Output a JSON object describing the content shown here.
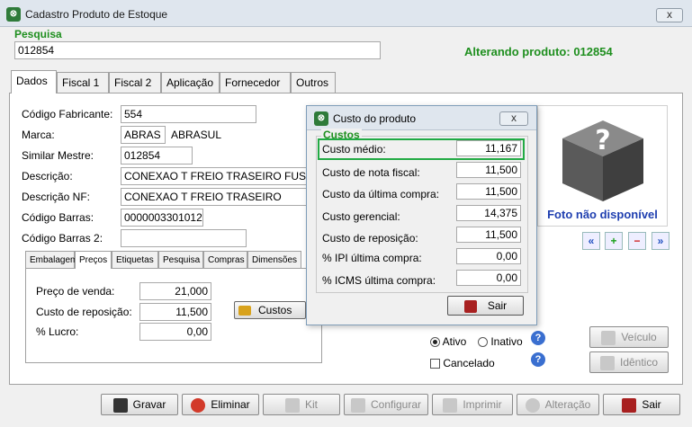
{
  "window": {
    "title": "Cadastro Produto de Estoque",
    "close_glyph": "x"
  },
  "search": {
    "label": "Pesquisa",
    "value": "012854",
    "status": "Alterando produto: 012854"
  },
  "tabs": [
    {
      "label": "Dados"
    },
    {
      "label": "Fiscal 1"
    },
    {
      "label": "Fiscal 2"
    },
    {
      "label": "Aplicação"
    },
    {
      "label": "Fornecedor"
    },
    {
      "label": "Outros"
    }
  ],
  "fields": {
    "codigo_fabricante": {
      "label": "Código Fabricante:",
      "value": "554"
    },
    "marca": {
      "label": "Marca:",
      "value": "ABRAS",
      "name": "ABRASUL"
    },
    "similar_mestre": {
      "label": "Similar Mestre:",
      "value": "012854"
    },
    "descricao": {
      "label": "Descrição:",
      "value": "CONEXAO T FREIO TRASEIRO FUSCA"
    },
    "descricao_nf": {
      "label": "Descrição NF:",
      "value": "CONEXAO T FREIO TRASEIRO"
    },
    "codigo_barras": {
      "label": "Código Barras:",
      "value": "0000003301012"
    },
    "codigo_barras_2": {
      "label": "Código Barras 2:",
      "value": ""
    }
  },
  "subtabs": [
    {
      "label": "Embalagem"
    },
    {
      "label": "Preços"
    },
    {
      "label": "Etiquetas"
    },
    {
      "label": "Pesquisa"
    },
    {
      "label": "Compras"
    },
    {
      "label": "Dimensões"
    }
  ],
  "prices": {
    "preco_venda": {
      "label": "Preço de venda:",
      "value": "21,000"
    },
    "custo_reposicao": {
      "label": "Custo de reposição:",
      "value": "11,500"
    },
    "lucro": {
      "label": "% Lucro:",
      "value": "0,00"
    },
    "custos_button": "Custos"
  },
  "photo": {
    "placeholder": "Foto não disponível",
    "icon": "question-cube-icon"
  },
  "status": {
    "ativo": "Ativo",
    "inativo": "Inativo",
    "cancelado": "Cancelado",
    "selected": "Ativo"
  },
  "side_buttons": {
    "veiculo": "Veículo",
    "identico": "Idêntico"
  },
  "bottom_buttons": {
    "gravar": "Gravar",
    "eliminar": "Eliminar",
    "kit": "Kit",
    "configurar": "Configurar",
    "imprimir": "Imprimir",
    "alteracao": "Alteração",
    "sair": "Sair"
  },
  "dialog": {
    "title": "Custo do produto",
    "group_label": "Custos",
    "rows": [
      {
        "label": "Custo médio:",
        "value": "11,167"
      },
      {
        "label": "Custo de nota fiscal:",
        "value": "11,500"
      },
      {
        "label": "Custo da última compra:",
        "value": "11,500"
      },
      {
        "label": "Custo gerencial:",
        "value": "14,375"
      },
      {
        "label": "Custo de reposição:",
        "value": "11,500"
      },
      {
        "label": "% IPI última compra:",
        "value": "0,00"
      },
      {
        "label": "% ICMS última compra:",
        "value": "0,00"
      }
    ],
    "sair": "Sair"
  },
  "colors": {
    "green": "#1f8f1f",
    "photo_text": "#1f3fb0",
    "highlight": "#22aa44"
  }
}
